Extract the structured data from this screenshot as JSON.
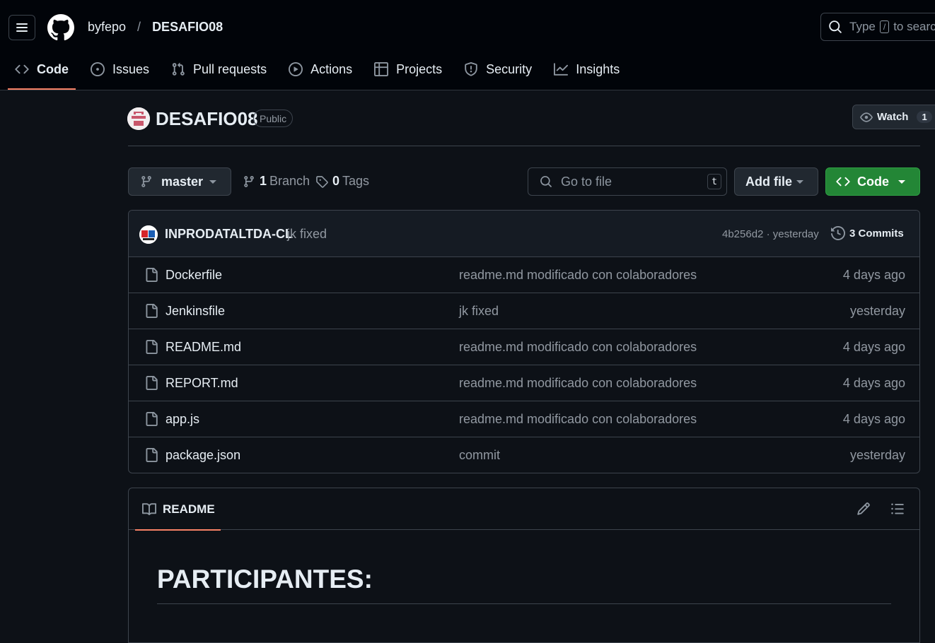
{
  "header": {
    "owner": "byfepo",
    "separator": "/",
    "repo": "DESAFIO08",
    "search_prefix": "Type",
    "search_key": "/",
    "search_suffix": "to search"
  },
  "nav_tabs": [
    {
      "label": "Code",
      "icon": "code-icon",
      "selected": true
    },
    {
      "label": "Issues",
      "icon": "issue-opened-icon"
    },
    {
      "label": "Pull requests",
      "icon": "git-pull-request-icon"
    },
    {
      "label": "Actions",
      "icon": "play-icon"
    },
    {
      "label": "Projects",
      "icon": "table-icon"
    },
    {
      "label": "Security",
      "icon": "shield-icon"
    },
    {
      "label": "Insights",
      "icon": "graph-icon"
    }
  ],
  "repo": {
    "name": "DESAFIO08",
    "visibility": "Public",
    "watch_label": "Watch",
    "watch_count": "1"
  },
  "toolbar": {
    "branch": "master",
    "branch_count": "1",
    "branch_label": "Branch",
    "tag_count": "0",
    "tag_label": "Tags",
    "go_to_file_placeholder": "Go to file",
    "go_to_file_key": "t",
    "add_file_label": "Add file",
    "code_label": "Code"
  },
  "last_commit": {
    "author": "INPRODATALTDA-CL",
    "message": "jk fixed",
    "meta": "4b256d2 · yesterday",
    "commits_label": "3 Commits"
  },
  "files": [
    {
      "name": "Dockerfile",
      "message": "readme.md modificado con colaboradores",
      "date": "4 days ago"
    },
    {
      "name": "Jenkinsfile",
      "message": "jk fixed",
      "date": "yesterday"
    },
    {
      "name": "README.md",
      "message": "readme.md modificado con colaboradores",
      "date": "4 days ago"
    },
    {
      "name": "REPORT.md",
      "message": "readme.md modificado con colaboradores",
      "date": "4 days ago"
    },
    {
      "name": "app.js",
      "message": "readme.md modificado con colaboradores",
      "date": "4 days ago"
    },
    {
      "name": "package.json",
      "message": "commit",
      "date": "yesterday"
    }
  ],
  "readme": {
    "tab_label": "README",
    "heading": "PARTICIPANTES:"
  },
  "colors": {
    "background": "#0d1117",
    "header": "#010409",
    "accent_underline": "#f78166",
    "code_button": "#238636"
  }
}
